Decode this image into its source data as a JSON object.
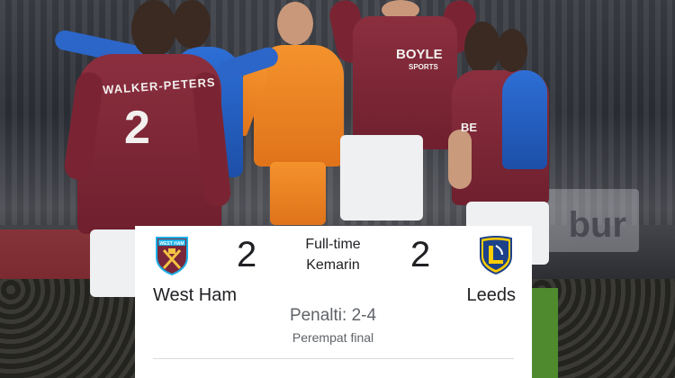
{
  "match": {
    "home_team": "West Ham",
    "away_team": "Leeds",
    "home_score": "2",
    "away_score": "2",
    "status": "Full-time",
    "date": "Kemarin",
    "penalties": "Penalti: 2-4",
    "stage": "Perempat final"
  },
  "photo": {
    "player_name": "WALKER-PETERS",
    "player_number": "2",
    "sponsor": "BOYLE",
    "sponsor_sub": "SPORTS",
    "sponsor_right": "BE",
    "board_text": "bur"
  },
  "colors": {
    "home_claret": "#7a263a",
    "home_blue": "#1bb1e7",
    "away_yellow": "#ffcd00",
    "away_blue": "#1d428a",
    "text_primary": "#202124",
    "text_secondary": "#5f6368"
  }
}
